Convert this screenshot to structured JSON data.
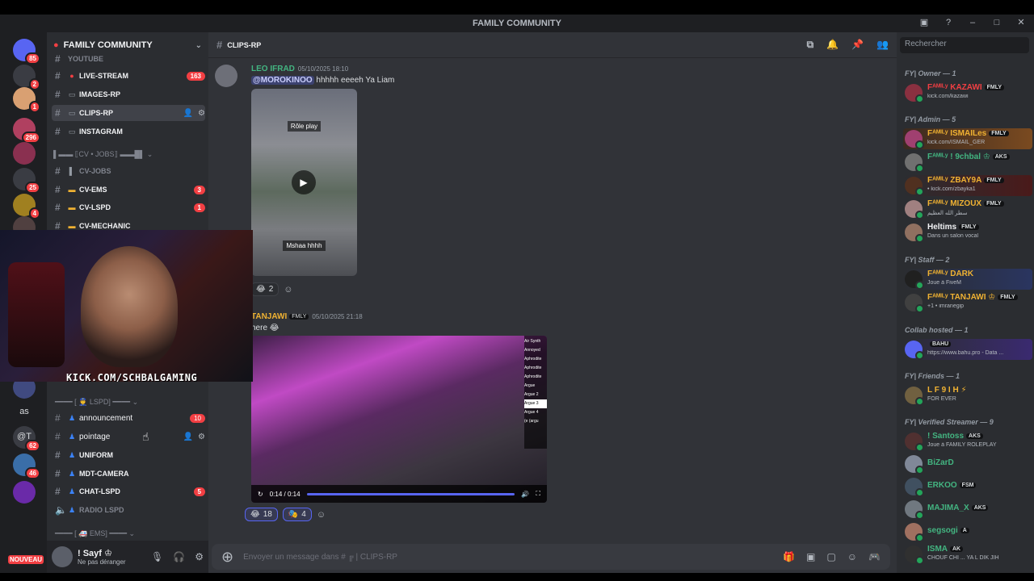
{
  "window": {
    "title": "FAMILY COMMUNITY"
  },
  "guild_badges": [
    "85",
    "2",
    "1",
    "296",
    "25",
    "4",
    "62",
    "46"
  ],
  "guild_text": {
    "as": "as",
    "at": "@T"
  },
  "nouveau": "NOUVEAU",
  "server": {
    "name": "FAMILY COMMUNITY"
  },
  "channels": {
    "youtube": "YOUTUBE",
    "live_stream": "LIVE-STREAM",
    "live_stream_badge": "163",
    "images_rp": "IMAGES-RP",
    "clips_rp": "CLIPS-RP",
    "instagram": "INSTAGRAM",
    "cat_cv_jobs": "▌▬▬ ⟦CV • JOBS⟧ ▬▬█▌ ⌄",
    "cv_jobs": "CV-JOBS",
    "cv_ems": "CV-EMS",
    "cv_ems_badge": "3",
    "cv_lspd": "CV-LSPD",
    "cv_lspd_badge": "1",
    "cv_mechanic": "CV-MECHANIC",
    "cat_lspd": "━━━━ [ 👮 LSPD] ━━━━ ⌄",
    "announcement": "announcement",
    "announcement_badge": "10",
    "pointage": "pointage",
    "uniform": "UNIFORM",
    "mdt_camera": "MDT-CAMERA",
    "chat_lspd": "CHAT-LSPD",
    "chat_lspd_badge": "5",
    "radio_lspd": "RADIO LSPD",
    "cat_ems": "━━━━ [ 🚑 EMS] ━━━━ ⌄"
  },
  "user": {
    "name": "! Sayf ♔",
    "status": "Ne pas déranger"
  },
  "channel_header": {
    "name": "CLIPS-RP"
  },
  "messages": [
    {
      "author": "LEO IFRAD",
      "timestamp": "05/10/2025 18:10",
      "mention": "@MOROKINOO",
      "text": "hhhhh eeeeh Ya Liam",
      "video_caption_top": "Rôle play",
      "video_caption_bottom": "Mshaa hhhh",
      "reaction_count": "2"
    },
    {
      "author": "TANJAWI",
      "author_tag": "FMLY",
      "timestamp": "05/10/2025 21:18",
      "text": "here 😂",
      "video_time": "0:14 / 0:14",
      "video_menu": [
        "Air Synth",
        "Annoyed",
        "Aphrodite",
        "Aphrodite",
        "Aphrodite",
        "Argue",
        "Argue 2",
        "Argue 3",
        "Argue 4",
        "(e (argu"
      ],
      "reactions": [
        {
          "emoji": "😂",
          "count": "18"
        },
        {
          "emoji": "🎭",
          "count": "4"
        }
      ]
    }
  ],
  "composer": {
    "placeholder": "Envoyer un message dans # ╔ |  CLIPS-RP"
  },
  "webcam": {
    "overlay_text": "KICK.COM/SCHBALGAMING"
  },
  "members": {
    "search_placeholder": "Rechercher",
    "groups": [
      {
        "heading": "FY| Owner — 1",
        "members": [
          {
            "name": "Fᴬᴹᴵᴸʸ KAZAWI",
            "tag": "FMLY",
            "status": "kick.com/kazawi",
            "color": "#f23f43"
          }
        ]
      },
      {
        "heading": "FY| Admin — 5",
        "members": [
          {
            "name": "Fᴬᴹᴵᴸʸ ISMAILes",
            "tag": "FMLY",
            "status": "kick.com/ISMAIL_GER",
            "color": "#f0b232"
          },
          {
            "name": "Fᴬᴹᴵᴸʸ ! 9chbal ♔",
            "tag": "AKS",
            "status": "",
            "color": "#43b581"
          },
          {
            "name": "Fᴬᴹᴵᴸʸ ZBAY9A",
            "tag": "FMLY",
            "status": "• kick.com/zbayka1",
            "color": "#f0b232"
          },
          {
            "name": "Fᴬᴹᴵᴸʸ MIZOUX",
            "tag": "FMLY",
            "status": "سطر الله العظيم",
            "color": "#f0b232"
          },
          {
            "name": "Heltims",
            "tag": "FMLY",
            "status": "Dans un salon vocal",
            "color": "#f2f3f5"
          }
        ]
      },
      {
        "heading": "FY| Staff — 2",
        "members": [
          {
            "name": "Fᴬᴹᴵᴸʸ DARK",
            "tag": "",
            "status": "Joue à FiveM",
            "color": "#f0b232"
          },
          {
            "name": "Fᴬᴹᴵᴸʸ TANJAWI ♔",
            "tag": "FMLY",
            "status": "+1 • imranegip",
            "color": "#f0b232"
          }
        ]
      },
      {
        "heading": "Collab hosted — 1",
        "members": [
          {
            "name": "BAHU",
            "tag": "BAHU",
            "status": "https://www.bahu.pro - Data ...",
            "color": "#5865f2"
          }
        ]
      },
      {
        "heading": "FY| Friends — 1",
        "members": [
          {
            "name": "L F 9 I H ⚡",
            "tag": "",
            "status": "FOR EVER",
            "color": "#f0b232"
          }
        ]
      },
      {
        "heading": "FY| Verified Streamer — 9",
        "members": [
          {
            "name": "! Santoss",
            "tag": "AKS",
            "status": "Joue à FAMILY ROLEPLAY",
            "color": "#43b581"
          },
          {
            "name": "BiZarD",
            "tag": "",
            "status": "",
            "color": "#43b581"
          },
          {
            "name": "ERKOO",
            "tag": "FSM",
            "status": "",
            "color": "#43b581"
          },
          {
            "name": "MAJIMA_X",
            "tag": "AKS",
            "status": "",
            "color": "#43b581"
          },
          {
            "name": "segsogi",
            "tag": "A",
            "status": "",
            "color": "#43b581"
          },
          {
            "name": "ISMA",
            "tag": "AK",
            "status": "CHOUF CHI ... YA L DIK JIH",
            "color": "#43b581"
          }
        ]
      }
    ]
  },
  "colors": {
    "blurple": "#5865f2",
    "red": "#f23f43",
    "green": "#43b581",
    "gold": "#f0b232"
  }
}
